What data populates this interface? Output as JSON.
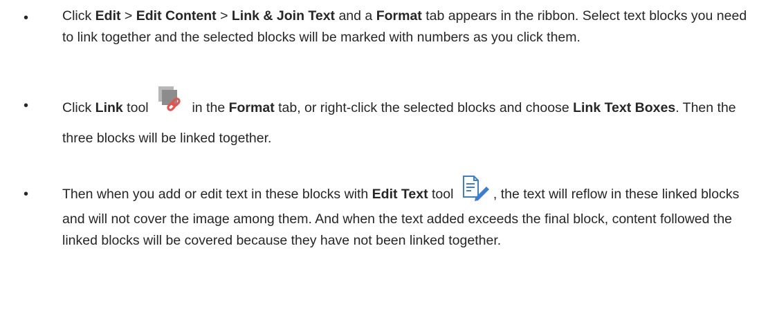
{
  "bullets": [
    {
      "marker": "•",
      "segments": [
        {
          "text": "Click ",
          "bold": false
        },
        {
          "text": "Edit",
          "bold": true
        },
        {
          "text": " > ",
          "bold": false
        },
        {
          "text": "Edit Content",
          "bold": true
        },
        {
          "text": " > ",
          "bold": false
        },
        {
          "text": "Link & Join Text",
          "bold": true
        },
        {
          "text": " and a ",
          "bold": false
        },
        {
          "text": "Format",
          "bold": true
        },
        {
          "text": " tab appears in the ribbon. Select text blocks you need to link together and the selected blocks will be marked with numbers as you click them.",
          "bold": false
        }
      ]
    },
    {
      "marker": "•",
      "segments": [
        {
          "text": "Click ",
          "bold": false
        },
        {
          "text": "Link",
          "bold": true
        },
        {
          "text": " tool ",
          "bold": false
        },
        {
          "icon": "link-tool-icon"
        },
        {
          "text": " in the ",
          "bold": false
        },
        {
          "text": "Format",
          "bold": true
        },
        {
          "text": " tab, or right-click the selected blocks and choose ",
          "bold": false
        },
        {
          "text": "Link Text Boxes",
          "bold": true
        },
        {
          "text": ". Then the three blocks will be linked together.",
          "bold": false
        }
      ]
    },
    {
      "marker": "•",
      "segments": [
        {
          "text": "Then when you add or edit text in these blocks with ",
          "bold": false
        },
        {
          "text": "Edit Text",
          "bold": true
        },
        {
          "text": " tool ",
          "bold": false
        },
        {
          "icon": "edit-text-tool-icon"
        },
        {
          "text": ", the text will reflow in these linked blocks and will not cover the image among them. And when the text added exceeds the final block, content followed the linked blocks will be covered because they have not been linked together.",
          "bold": false
        }
      ]
    }
  ],
  "icons": {
    "link_tool": {
      "name": "link-tool-icon",
      "colors": {
        "sheet": "#8c8c8c",
        "sheet_back": "#b8b8b8",
        "chain": "#e8524a"
      }
    },
    "edit_text_tool": {
      "name": "edit-text-tool-icon",
      "colors": {
        "doc": "#3c7fd1",
        "pen": "#3c7fd1"
      }
    }
  }
}
